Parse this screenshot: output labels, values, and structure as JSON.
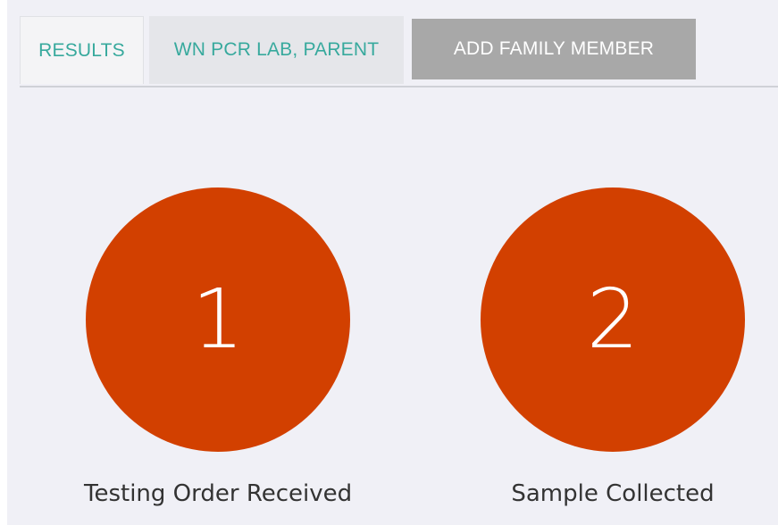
{
  "tabs": {
    "results_label": "RESULTS",
    "parent_label": "WN PCR LAB, PARENT",
    "add_member_label": "ADD FAMILY MEMBER"
  },
  "steps": [
    {
      "number": "1",
      "label": "Testing Order Received"
    },
    {
      "number": "2",
      "label": "Sample Collected"
    }
  ],
  "colors": {
    "accent_text": "#37a99d",
    "step_circle": "#d24000",
    "add_button_bg": "#a8a8a8",
    "background": "#f0f0f6"
  }
}
